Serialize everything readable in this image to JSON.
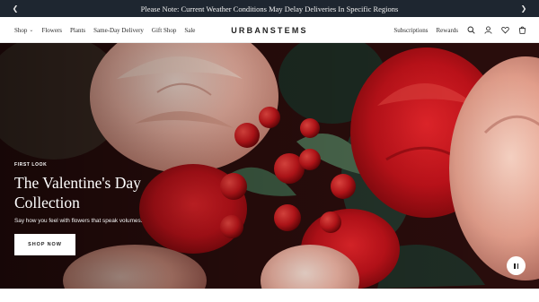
{
  "announcement": {
    "text": "Please Note: Current Weather Conditions May Delay Deliveries In Specific Regions",
    "prev_icon": "chevron-left-icon",
    "next_icon": "chevron-right-icon"
  },
  "nav": {
    "left": [
      {
        "label": "Shop",
        "has_dropdown": true
      },
      {
        "label": "Flowers"
      },
      {
        "label": "Plants"
      },
      {
        "label": "Same-Day Delivery"
      },
      {
        "label": "Gift Shop"
      },
      {
        "label": "Sale"
      }
    ],
    "logo": "URBANSTEMS",
    "right": {
      "subscriptions": "Subscriptions",
      "rewards": "Rewards",
      "icons": [
        "search-icon",
        "account-icon",
        "favorites-icon",
        "cart-icon"
      ]
    }
  },
  "hero": {
    "kicker": "FIRST LOOK",
    "title": "The Valentine's Day Collection",
    "subtitle": "Say how you feel with flowers that speak volumes.",
    "cta": "SHOP NOW",
    "pause_icon": "pause-icon"
  },
  "colors": {
    "announcement_bg": "#1e2630",
    "hero_dark": "#2a0d0c",
    "rose_red": "#c8141b",
    "rose_pink": "#f0b8a8"
  }
}
